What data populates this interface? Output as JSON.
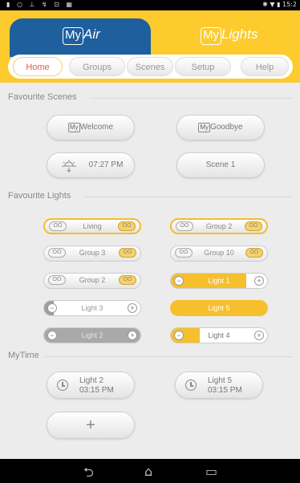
{
  "status": {
    "left_icons": "▮ ○ ⊥ ↯ ⊡ ▦",
    "right_icons": "✱ ▼ ▮",
    "time": "15:2"
  },
  "tabs": {
    "myair_my": "My",
    "myair_rest": "Air",
    "mylights_my": "My",
    "mylights_rest": "Lights"
  },
  "nav": {
    "home": "Home",
    "groups": "Groups",
    "scenes": "Scenes",
    "setup": "Setup",
    "help": "Help"
  },
  "favourite_scenes": {
    "title": "Favourite Scenes",
    "welcome_my": "My",
    "welcome_rest": "Welcome",
    "goodbye_my": "My",
    "goodbye_rest": "Goodbye",
    "sunset_time": "07:27 PM",
    "scene1": "Scene 1"
  },
  "favourite_lights": {
    "title": "Favourite Lights",
    "items": [
      {
        "label": "Living",
        "knob_left": "OO",
        "knob_right": "OO"
      },
      {
        "label": "Group 2",
        "knob_left": "OO",
        "knob_right": "OO"
      },
      {
        "label": "Group 3",
        "knob_left": "OO",
        "knob_right": "OO"
      },
      {
        "label": "Group 10",
        "knob_left": "OO",
        "knob_right": "OO"
      },
      {
        "label": "Group 2",
        "knob_left": "OO",
        "knob_right": "OO"
      }
    ],
    "light1": {
      "label": "Light 1",
      "level": 0.78
    },
    "light3": {
      "label": "Light 3",
      "level": 0.1
    },
    "light5": {
      "label": "Light 5",
      "level": 1.0
    },
    "light2": {
      "label": "Light 2",
      "level": 1.0
    },
    "light4": {
      "label": "Light 4",
      "level": 0.3
    },
    "minus": "−",
    "plus": "+"
  },
  "mytime": {
    "title": "MyTime",
    "items": [
      {
        "name": "Light 2",
        "time": "03:15 PM"
      },
      {
        "name": "Light 5",
        "time": "03:15 PM"
      }
    ],
    "add_label": "+"
  },
  "colors": {
    "brand_yellow": "#fdcb2e",
    "brand_blue": "#1e5f9d",
    "accent_orange": "#e8583c"
  },
  "android_nav": {
    "back": "⮌",
    "home": "⌂",
    "recent": "▭"
  }
}
